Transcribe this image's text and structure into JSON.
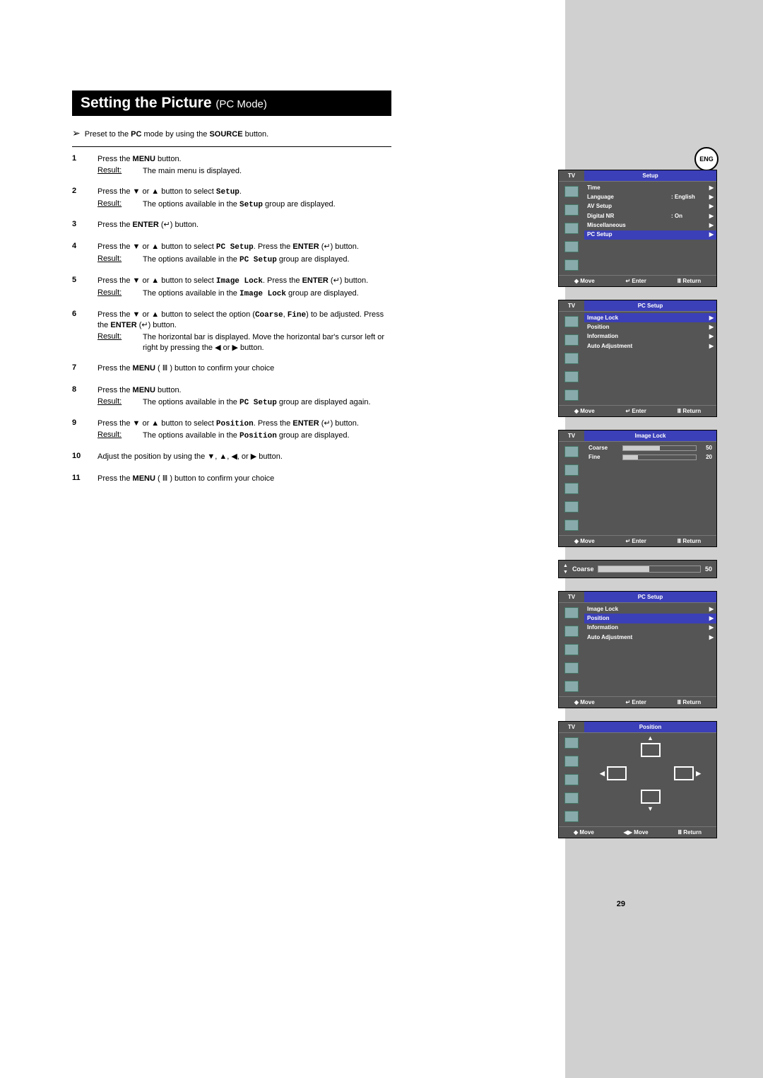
{
  "lang_badge": "ENG",
  "page_number": "29",
  "title_main": "Setting the Picture",
  "title_mode": "(PC Mode)",
  "preset_note_pre": "Preset to the ",
  "preset_note_pc": "PC",
  "preset_note_mid": " mode by using the ",
  "preset_note_src": "SOURCE",
  "preset_note_post": " button.",
  "steps": {
    "s1_a": "Press the ",
    "s1_b": "MENU",
    "s1_c": " button.",
    "s1_result": "The main menu is displayed.",
    "s2_a": "Press the ▼ or ▲ button to select ",
    "s2_code": "Setup",
    "s2_b": ".",
    "s2_result_a": "The options available in the ",
    "s2_result_b": " group are displayed.",
    "s3_a": "Press the ",
    "s3_b": "ENTER",
    "s3_c": " (↵) button.",
    "s4_a": "Press the ▼ or ▲ button to select ",
    "s4_code": "PC Setup",
    "s4_b": ". Press the ",
    "s4_c": "ENTER",
    "s4_d": " (↵) button.",
    "s4_result_a": "The options available in the ",
    "s4_result_b": " group are displayed.",
    "s5_a": "Press the ▼ or ▲ button to select ",
    "s5_code": "Image Lock",
    "s5_b": ". Press the ",
    "s5_c": "ENTER",
    "s5_d": " (↵) button.",
    "s5_result_a": "The options available in the ",
    "s5_result_b": " group are displayed.",
    "s6_a": "Press the ▼ or ▲ button to select the option (",
    "s6_code1": "Coarse",
    "s6_mid": ", ",
    "s6_code2": "Fine",
    "s6_b": ") to be adjusted. Press the ",
    "s6_c": "ENTER",
    "s6_d": " (↵) button.",
    "s6_result": "The horizontal bar is displayed. Move the horizontal bar's cursor left or right by pressing the ◀ or ▶ button.",
    "s7_a": "Press the ",
    "s7_b": "MENU",
    "s7_c": " ( Ⅲ ) button to confirm your choice",
    "s8_a": "Press the ",
    "s8_b": "MENU",
    "s8_c": " button.",
    "s8_result_a": "The options available in the ",
    "s8_result_code": "PC Setup",
    "s8_result_b": " group are displayed again.",
    "s9_a": "Press the ▼ or ▲ button to select ",
    "s9_code": "Position",
    "s9_b": ". Press the ",
    "s9_c": "ENTER",
    "s9_d": " (↵) button.",
    "s9_result_a": "The options available in the ",
    "s9_result_b": " group are displayed.",
    "s10": "Adjust the position by using the ▼, ▲, ◀, or ▶ button.",
    "s11_a": "Press the ",
    "s11_b": "MENU",
    "s11_c": " ( Ⅲ ) button to confirm your choice"
  },
  "result_label": "Result:",
  "osd": {
    "tv": "TV",
    "move": "◆ Move",
    "move_lr": "◀▶ Move",
    "enter": "↵ Enter",
    "return": "Ⅲ Return",
    "setup": {
      "title": "Setup",
      "items": [
        {
          "label": "Time",
          "val": "",
          "arr": "▶"
        },
        {
          "label": "Language",
          "val": ": English",
          "arr": "▶"
        },
        {
          "label": "AV Setup",
          "val": "",
          "arr": "▶"
        },
        {
          "label": "Digital NR",
          "val": ": On",
          "arr": "▶"
        },
        {
          "label": "Miscellaneous",
          "val": "",
          "arr": "▶"
        },
        {
          "label": "PC Setup",
          "val": "",
          "arr": "▶",
          "sel": true
        }
      ]
    },
    "pcsetup": {
      "title": "PC Setup",
      "items": [
        {
          "label": "Image Lock",
          "arr": "▶",
          "sel": true
        },
        {
          "label": "Position",
          "arr": "▶"
        },
        {
          "label": "Information",
          "arr": "▶"
        },
        {
          "label": "Auto Adjustment",
          "arr": "▶"
        }
      ]
    },
    "imagelock": {
      "title": "Image Lock",
      "coarse_label": "Coarse",
      "coarse_val": "50",
      "fine_label": "Fine",
      "fine_val": "20"
    },
    "mini": {
      "label": "Coarse",
      "val": "50"
    },
    "pcsetup2": {
      "title": "PC Setup",
      "items": [
        {
          "label": "Image Lock",
          "arr": "▶"
        },
        {
          "label": "Position",
          "arr": "▶",
          "sel": true
        },
        {
          "label": "Information",
          "arr": "▶"
        },
        {
          "label": "Auto Adjustment",
          "arr": "▶"
        }
      ]
    },
    "position": {
      "title": "Position"
    }
  }
}
